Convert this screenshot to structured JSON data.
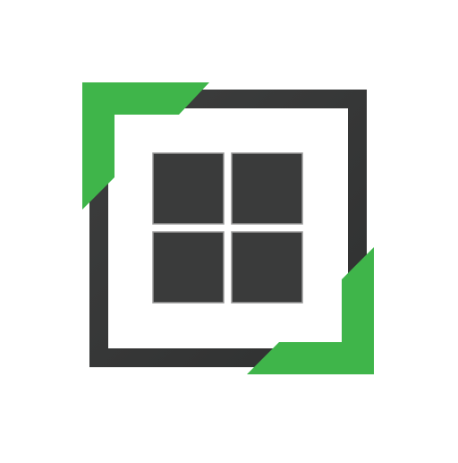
{
  "icon": {
    "name": "window-grid-app-icon",
    "colors": {
      "background": "#ffffff",
      "frame": "#3a3b3b",
      "frame_shade": "#2b2c2c",
      "accent": "#3fb54a",
      "tile": "#3a3b3b",
      "tile_border": "#9a9a9a"
    }
  }
}
